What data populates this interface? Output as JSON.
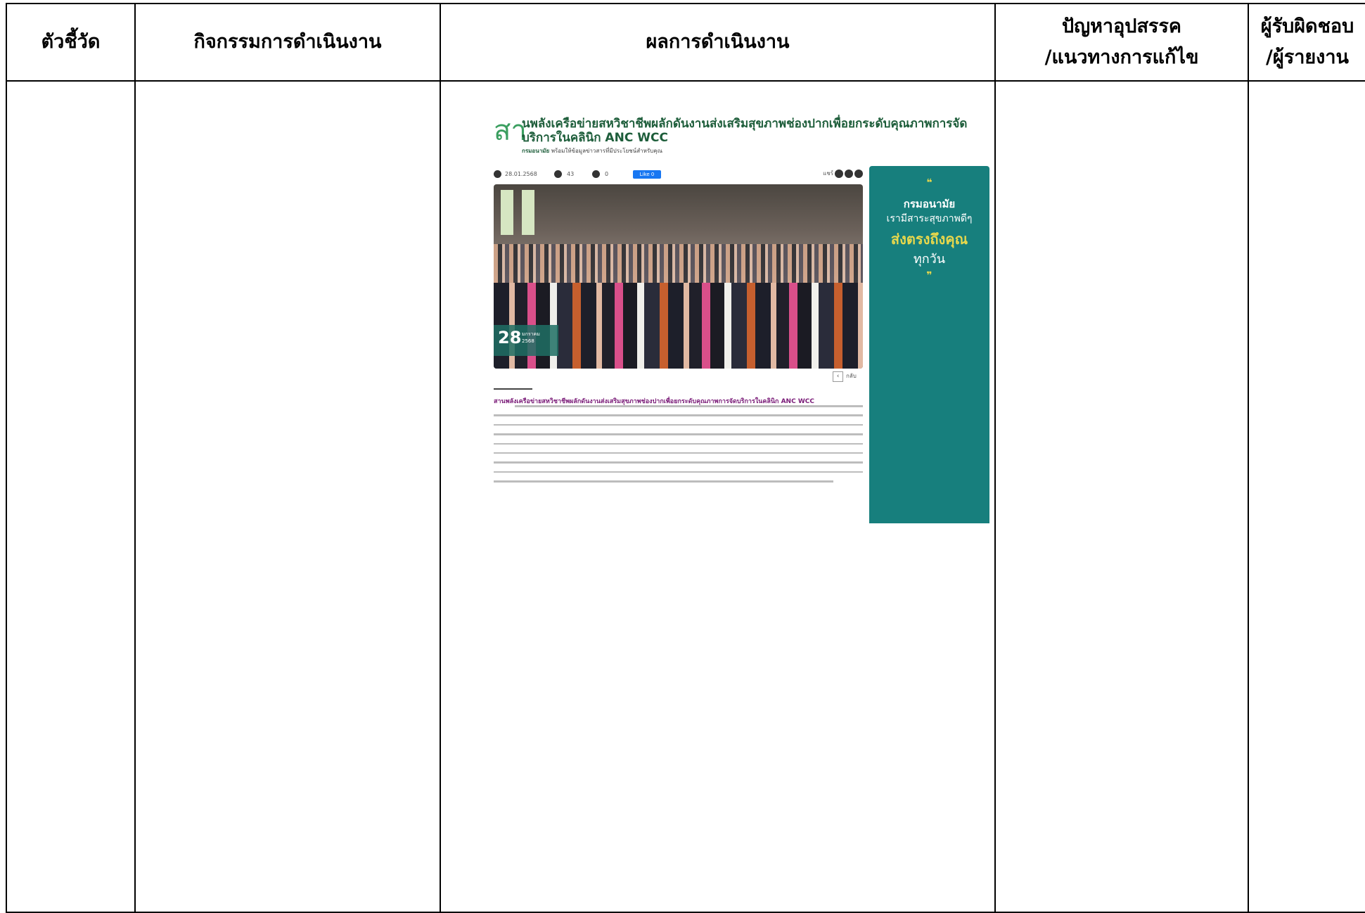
{
  "table": {
    "headers": [
      {
        "line1": "ตัวชี้วัด",
        "line2": ""
      },
      {
        "line1": "กิจกรรมการดำเนินงาน",
        "line2": ""
      },
      {
        "line1": "ผลการดำเนินงาน",
        "line2": ""
      },
      {
        "line1": "ปัญหาอุปสรรค",
        "line2": "/แนวทางการแก้ไข"
      },
      {
        "line1": "ผู้รับผิดชอบ",
        "line2": "/ผู้รายงาน"
      }
    ]
  },
  "news": {
    "big_prefix": "สา",
    "title_line1": "นพลังเครือข่ายสหวิชาชีพผลักดันงานส่งเสริมสุขภาพช่องปากเพื่อยกระดับคุณภาพการจัด",
    "title_line2": "บริการในคลินิก ANC WCC",
    "subtitle_org": "กรมอนามัย",
    "subtitle_text": "พร้อมให้ข้อมูลข่าวสารที่มีประโยชน์สำหรับคุณ",
    "date": "28.01.2568",
    "views": "43",
    "shares": "0",
    "like_label": "Like 0",
    "share_label": "แชร์",
    "badge_day": "28",
    "badge_month": "มกราคม",
    "badge_year": "2568",
    "back_label": "กลับ",
    "article_title": "สานพลังเครือข่ายสหวิชาชีพผลักดันงานส่งเสริมสุขภาพช่องปากเพื่อยกระดับคุณภาพการจัดบริการในคลินิก ANC WCC",
    "sidebar": {
      "open_quote": "❝",
      "org": "กรมอนามัย",
      "line2": "เรามีสาระสุขภาพดีๆ",
      "line3": "ส่งตรงถึงคุณ",
      "line4": "ทุกวัน",
      "close_quote": "❞"
    }
  }
}
